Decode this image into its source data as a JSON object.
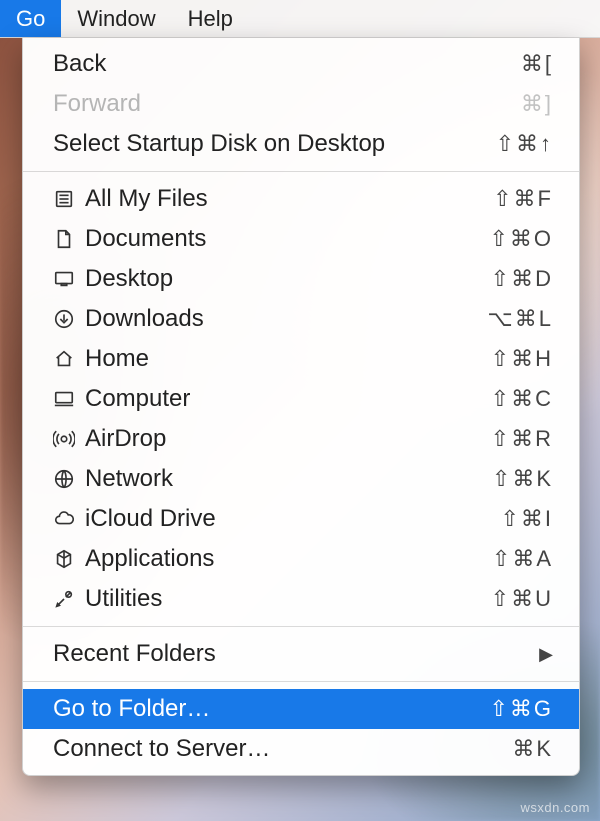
{
  "menubar": {
    "items": [
      {
        "label": "Go",
        "active": true
      },
      {
        "label": "Window",
        "active": false
      },
      {
        "label": "Help",
        "active": false
      }
    ]
  },
  "menu": {
    "sections": [
      [
        {
          "label": "Back",
          "shortcut": "⌘[",
          "icon": null,
          "disabled": false
        },
        {
          "label": "Forward",
          "shortcut": "⌘]",
          "icon": null,
          "disabled": true
        },
        {
          "label": "Select Startup Disk on Desktop",
          "shortcut": "⇧⌘↑",
          "icon": null,
          "disabled": false
        }
      ],
      [
        {
          "label": "All My Files",
          "shortcut": "⇧⌘F",
          "icon": "all-my-files-icon"
        },
        {
          "label": "Documents",
          "shortcut": "⇧⌘O",
          "icon": "documents-icon"
        },
        {
          "label": "Desktop",
          "shortcut": "⇧⌘D",
          "icon": "desktop-icon"
        },
        {
          "label": "Downloads",
          "shortcut": "⌥⌘L",
          "icon": "downloads-icon"
        },
        {
          "label": "Home",
          "shortcut": "⇧⌘H",
          "icon": "home-icon"
        },
        {
          "label": "Computer",
          "shortcut": "⇧⌘C",
          "icon": "computer-icon"
        },
        {
          "label": "AirDrop",
          "shortcut": "⇧⌘R",
          "icon": "airdrop-icon"
        },
        {
          "label": "Network",
          "shortcut": "⇧⌘K",
          "icon": "network-icon"
        },
        {
          "label": "iCloud Drive",
          "shortcut": "⇧⌘I",
          "icon": "icloud-icon"
        },
        {
          "label": "Applications",
          "shortcut": "⇧⌘A",
          "icon": "applications-icon"
        },
        {
          "label": "Utilities",
          "shortcut": "⇧⌘U",
          "icon": "utilities-icon"
        }
      ],
      [
        {
          "label": "Recent Folders",
          "shortcut": null,
          "icon": null,
          "submenu": true
        }
      ],
      [
        {
          "label": "Go to Folder…",
          "shortcut": "⇧⌘G",
          "icon": null,
          "highlight": true
        },
        {
          "label": "Connect to Server…",
          "shortcut": "⌘K",
          "icon": null
        }
      ]
    ]
  },
  "watermark": "wsxdn.com"
}
